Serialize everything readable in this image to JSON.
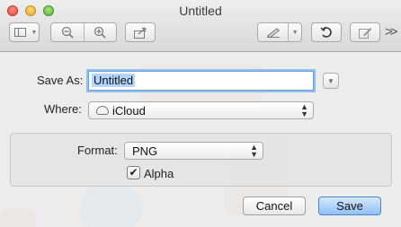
{
  "window": {
    "title": "Untitled"
  },
  "toolbar": {
    "icons": [
      "sidebar-icon",
      "zoom-out-icon",
      "zoom-in-icon",
      "share-icon",
      "markup-pen-icon",
      "rotate-icon",
      "edit-icon"
    ],
    "overflow_label": ">>"
  },
  "save_dialog": {
    "save_as_label": "Save As:",
    "file_name": "Untitled",
    "where_label": "Where:",
    "where_value": "iCloud",
    "format_label": "Format:",
    "format_value": "PNG",
    "alpha_label": "Alpha",
    "alpha_checked": true,
    "cancel_label": "Cancel",
    "save_label": "Save"
  },
  "colors": {
    "accent": "#8fc0f4",
    "focus_ring": "#93bfee",
    "close": "#e2463f",
    "minimize": "#e3a92a",
    "zoom": "#56b43a"
  }
}
